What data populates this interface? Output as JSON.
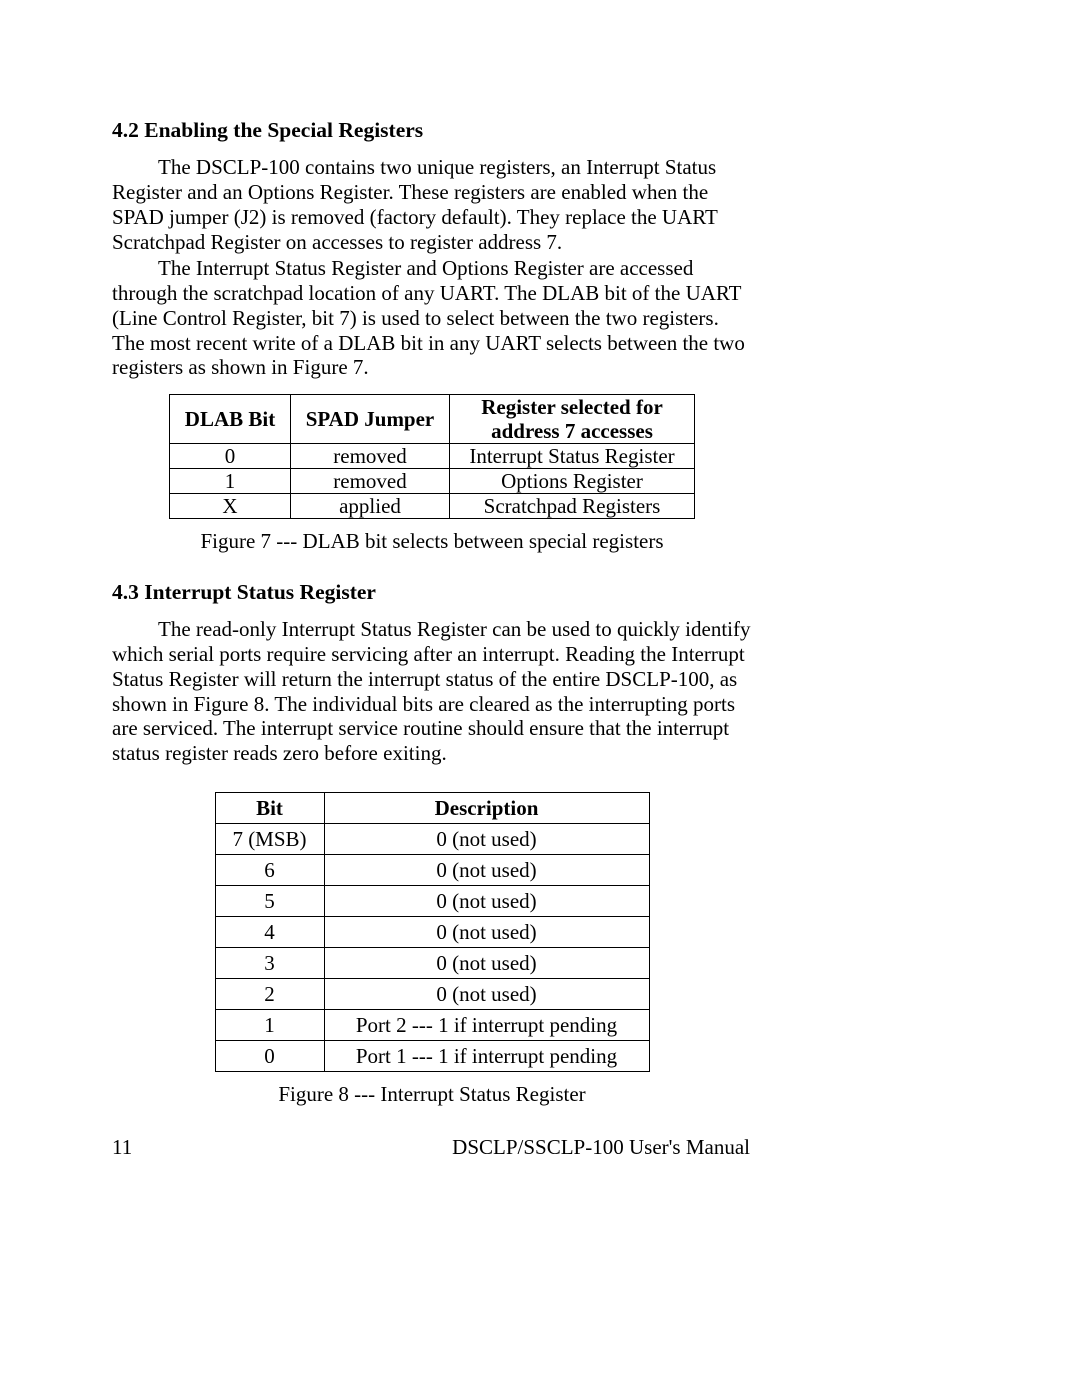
{
  "section42": {
    "heading": "4.2   Enabling the Special Registers",
    "para1": "The DSCLP-100 contains two unique registers, an Interrupt Status Register and an Options Register.  These registers are enabled when the SPAD jumper (J2) is removed (factory default).  They replace the UART Scratchpad Register on accesses to register address 7.",
    "para2": "The Interrupt Status Register and Options Register are  accessed through the scratchpad location of any UART.  The DLAB bit of the UART (Line Control Register, bit 7) is used to select between the two registers.  The most recent write of a DLAB bit in any UART selects between the two registers as shown in Figure 7.",
    "table": {
      "headers": [
        "DLAB Bit",
        "SPAD Jumper",
        "Register selected for address 7 accesses"
      ],
      "rows": [
        [
          "0",
          "removed",
          "Interrupt Status Register"
        ],
        [
          "1",
          "removed",
          "Options Register"
        ],
        [
          "X",
          "applied",
          "Scratchpad Registers"
        ]
      ]
    },
    "caption": "Figure 7 --- DLAB bit selects between special registers"
  },
  "section43": {
    "heading": "4.3   Interrupt Status Register",
    "para1": "The read-only Interrupt Status Register can be used to quickly identify which serial ports require servicing after an interrupt.  Reading the Interrupt Status Register will return the interrupt status of the entire DSCLP-100, as shown in Figure 8.  The individual bits are cleared as the interrupting ports are serviced.  The interrupt service routine should ensure that the interrupt status register reads zero before exiting.",
    "table": {
      "headers": [
        "Bit",
        "Description"
      ],
      "rows": [
        [
          "7  (MSB)",
          "0 (not used)"
        ],
        [
          "6",
          "0 (not used)"
        ],
        [
          "5",
          "0 (not used)"
        ],
        [
          "4",
          "0 (not used)"
        ],
        [
          "3",
          "0 (not used)"
        ],
        [
          "2",
          "0 (not used)"
        ],
        [
          "1",
          "Port 2 --- 1 if interrupt pending"
        ],
        [
          "0",
          "Port 1 --- 1 if interrupt pending"
        ]
      ]
    },
    "caption": "Figure 8 --- Interrupt Status Register"
  },
  "footer": {
    "page": "11",
    "manual": "DSCLP/SSCLP-100 User's Manual"
  }
}
